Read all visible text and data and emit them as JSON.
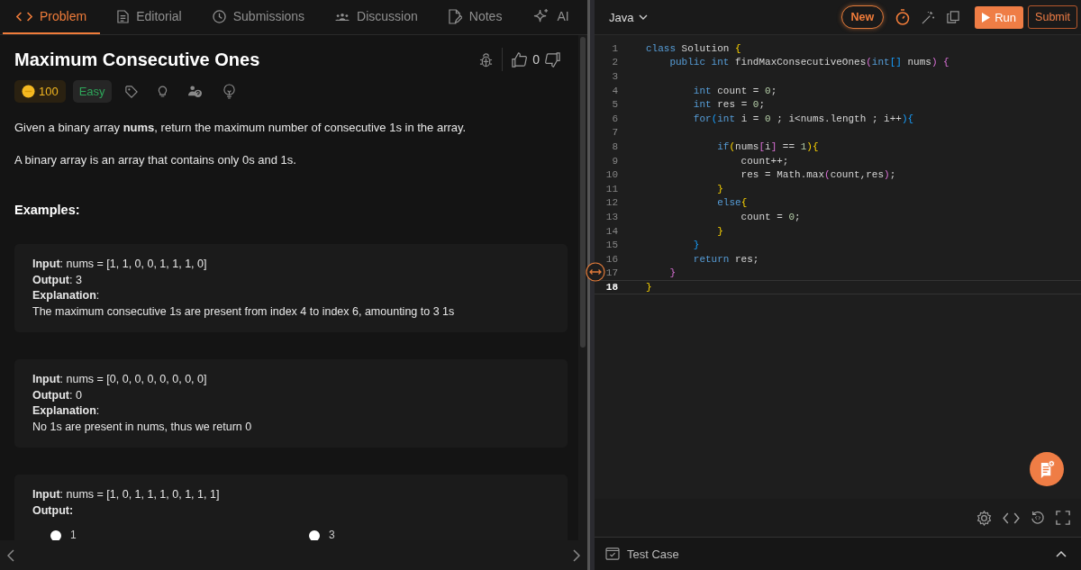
{
  "problem_tabs": [
    {
      "label": "Problem",
      "kind": "code",
      "selected": true
    },
    {
      "label": "Editorial",
      "kind": "document",
      "selected": false
    },
    {
      "label": "Submissions",
      "kind": "clock",
      "selected": false
    },
    {
      "label": "Discussion",
      "kind": "people",
      "selected": false
    },
    {
      "label": "Notes",
      "kind": "note",
      "selected": false
    },
    {
      "label": "AI",
      "kind": "sparkle",
      "selected": false
    }
  ],
  "problem": {
    "title": "Maximum Consecutive Ones",
    "likes": "0",
    "coins": "100",
    "difficulty": "Easy",
    "description": [
      "Given a binary array **nums**, return the maximum number of consecutive 1s in the array.",
      "A binary array is an array that contains only 0s and 1s."
    ],
    "examples_heading": "Examples:",
    "examples": [
      {
        "lines": [
          {
            "text": "**Input**: nums = [1, 1, 0, 0, 1, 1, 1, 0]",
            "bold": false
          },
          {
            "text": "**Output**: 3",
            "bold": false
          },
          {
            "text": "**Explanation**:",
            "bold": false
          },
          {
            "text": "The maximum consecutive 1s are present from index 4 to index 6, amounting to 3 1s",
            "bold": false
          }
        ]
      },
      {
        "lines": [
          {
            "text": "**Input**: nums = [0, 0, 0, 0, 0, 0, 0, 0]",
            "bold": false
          },
          {
            "text": "**Output**: 0",
            "bold": false
          },
          {
            "text": "**Explanation**:",
            "bold": false
          },
          {
            "text": "No 1s are present in nums, thus we return 0",
            "bold": false
          }
        ]
      },
      {
        "lines": [
          {
            "text": "**Input**: nums = [1, 0, 1, 1, 1, 0, 1, 1, 1]",
            "bold": false
          },
          {
            "text": "Output:",
            "bold": true
          }
        ],
        "options": [
          {
            "label": "1"
          },
          {
            "label": "3"
          }
        ]
      }
    ]
  },
  "editor": {
    "language": "Java",
    "new_label": "New",
    "run_label": "Run",
    "submit_label": "Submit",
    "lines": [
      {
        "number": "1",
        "current": false,
        "tokens": [
          {
            "text": "class",
            "kind": "kw"
          },
          {
            "text": " Solution ",
            "kind": "id"
          },
          {
            "text": "{",
            "kind": "b1"
          }
        ]
      },
      {
        "number": "2",
        "current": false,
        "tokens": [
          {
            "text": "    public int",
            "kind": "kw"
          },
          {
            "text": " findMaxConsecutiveOnes",
            "kind": "id"
          },
          {
            "text": "(",
            "kind": "b2"
          },
          {
            "text": "int",
            "kind": "kw"
          },
          {
            "text": "[]",
            "kind": "b3"
          },
          {
            "text": " nums",
            "kind": "id"
          },
          {
            "text": ") {",
            "kind": "b2"
          }
        ]
      },
      {
        "number": "3",
        "current": false
      },
      {
        "number": "4",
        "current": false,
        "tokens": [
          {
            "text": "        int",
            "kind": "kw"
          },
          {
            "text": " count = ",
            "kind": "id"
          },
          {
            "text": "0",
            "kind": "num"
          },
          {
            "text": ";",
            "kind": "id"
          }
        ]
      },
      {
        "number": "5",
        "current": false,
        "tokens": [
          {
            "text": "        int",
            "kind": "kw"
          },
          {
            "text": " res = ",
            "kind": "id"
          },
          {
            "text": "0",
            "kind": "num"
          },
          {
            "text": ";",
            "kind": "id"
          }
        ]
      },
      {
        "number": "6",
        "current": false,
        "tokens": [
          {
            "text": "        for",
            "kind": "kw"
          },
          {
            "text": "(",
            "kind": "b3"
          },
          {
            "text": "int",
            "kind": "kw"
          },
          {
            "text": " i = ",
            "kind": "id"
          },
          {
            "text": "0",
            "kind": "num"
          },
          {
            "text": " ; i<nums.length ; i++",
            "kind": "id"
          },
          {
            "text": "){",
            "kind": "b3"
          }
        ]
      },
      {
        "number": "7",
        "current": false
      },
      {
        "number": "8",
        "current": false,
        "tokens": [
          {
            "text": "            if",
            "kind": "kw"
          },
          {
            "text": "(",
            "kind": "b1"
          },
          {
            "text": "nums",
            "kind": "id"
          },
          {
            "text": "[",
            "kind": "b2"
          },
          {
            "text": "i",
            "kind": "id"
          },
          {
            "text": "]",
            "kind": "b2"
          },
          {
            "text": " == ",
            "kind": "id"
          },
          {
            "text": "1",
            "kind": "num"
          },
          {
            "text": "){",
            "kind": "b1"
          }
        ]
      },
      {
        "number": "9",
        "current": false,
        "tokens": [
          {
            "text": "                count++;",
            "kind": "id"
          }
        ]
      },
      {
        "number": "10",
        "current": false,
        "tokens": [
          {
            "text": "                res = Math.max",
            "kind": "id"
          },
          {
            "text": "(",
            "kind": "b2"
          },
          {
            "text": "count,res",
            "kind": "id"
          },
          {
            "text": ")",
            "kind": "b2"
          },
          {
            "text": ";",
            "kind": "id"
          }
        ]
      },
      {
        "number": "11",
        "current": false,
        "tokens": [
          {
            "text": "            }",
            "kind": "b1"
          }
        ]
      },
      {
        "number": "12",
        "current": false,
        "tokens": [
          {
            "text": "            else",
            "kind": "kw"
          },
          {
            "text": "{",
            "kind": "b1"
          }
        ]
      },
      {
        "number": "13",
        "current": false,
        "tokens": [
          {
            "text": "                count = ",
            "kind": "id"
          },
          {
            "text": "0",
            "kind": "num"
          },
          {
            "text": ";",
            "kind": "id"
          }
        ]
      },
      {
        "number": "14",
        "current": false,
        "tokens": [
          {
            "text": "            }",
            "kind": "b1"
          }
        ]
      },
      {
        "number": "15",
        "current": false,
        "tokens": [
          {
            "text": "        }",
            "kind": "b3"
          }
        ]
      },
      {
        "number": "16",
        "current": false,
        "tokens": [
          {
            "text": "        return",
            "kind": "kw"
          },
          {
            "text": " res;",
            "kind": "id"
          }
        ]
      },
      {
        "number": "17",
        "current": false,
        "tokens": [
          {
            "text": "    }",
            "kind": "b2"
          }
        ]
      },
      {
        "number": "18",
        "current": true,
        "tokens": [
          {
            "text": "}",
            "kind": "b1"
          }
        ]
      }
    ]
  },
  "test_case": {
    "label": "Test Case"
  }
}
